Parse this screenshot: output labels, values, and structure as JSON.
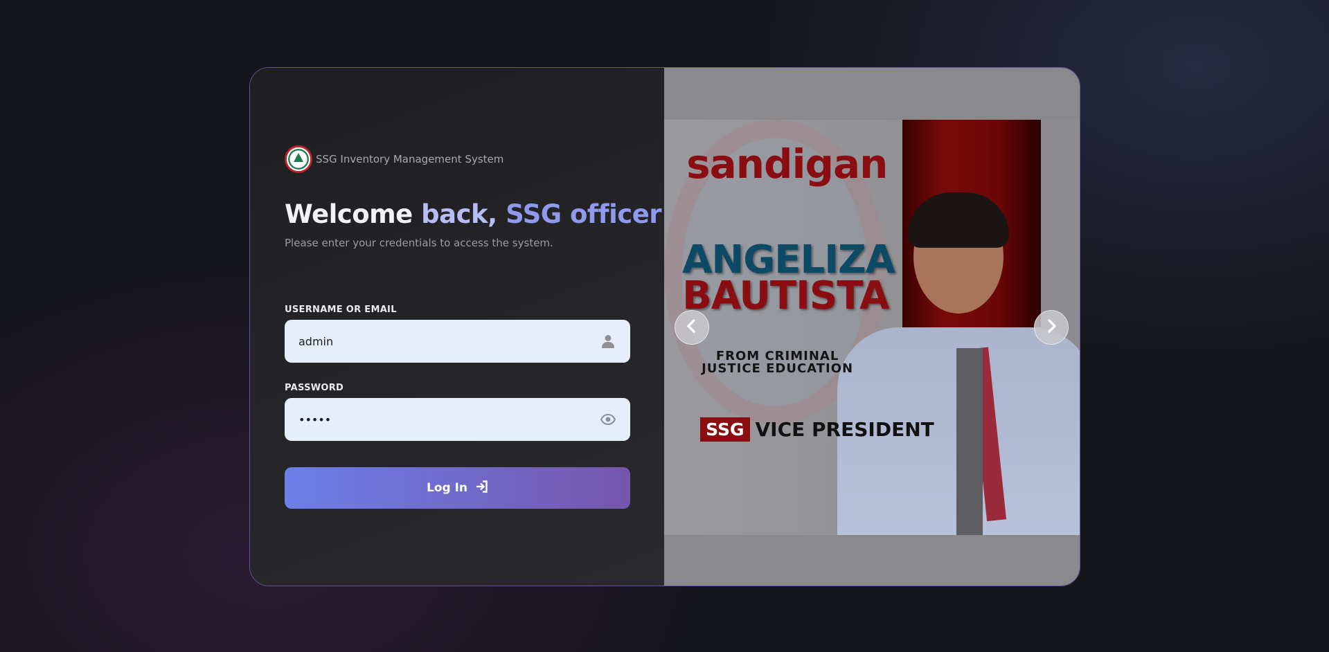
{
  "brand": {
    "name": "SSG Inventory Management System",
    "logo_icon": "ssg-seal-icon"
  },
  "welcome": {
    "part1": "Welcome",
    "part2": " back,",
    "part3": " SSG officer!"
  },
  "subtitle": "Please enter your credentials to access the system.",
  "form": {
    "username_label": "USERNAME OR EMAIL",
    "username_value": "admin",
    "username_icon": "user-icon",
    "password_label": "PASSWORD",
    "password_value": "•••••",
    "password_icon": "eye-icon",
    "login_label": "Log In",
    "login_icon": "sign-in-icon"
  },
  "carousel": {
    "slide": {
      "brand": "sandigan",
      "name_line1": "ANGELIZA",
      "name_line2": "BAUTISTA",
      "dept_line1": "FROM CRIMINAL",
      "dept_line2": "JUSTICE EDUCATION",
      "role_tag": "SSG",
      "role_text": "VICE PRESIDENT"
    },
    "prev_icon": "chevron-left-icon",
    "next_icon": "chevron-right-icon"
  },
  "colors": {
    "accent_start": "#6b7fe8",
    "accent_end": "#7656ad",
    "card_border": "#6b4fa0",
    "brand_red": "#8a0d12",
    "brand_blue": "#0c4a66"
  }
}
